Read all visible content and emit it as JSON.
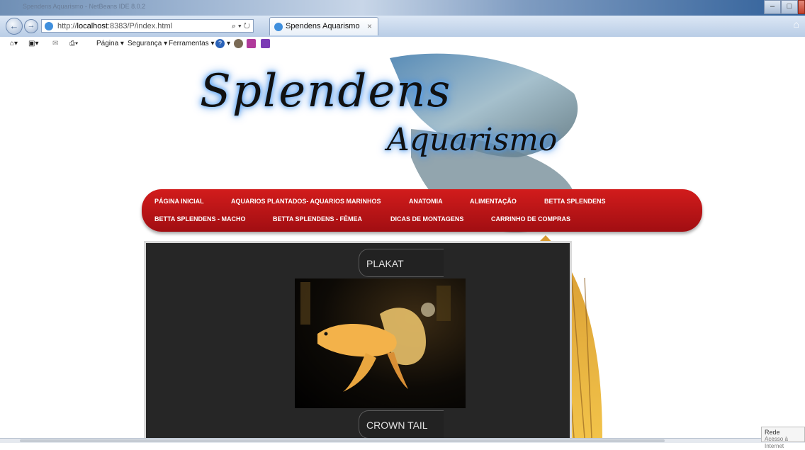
{
  "browser": {
    "window_title": "Spendens Aquarismo - NetBeans IDE 8.0.2",
    "address": {
      "prefix": "http://",
      "host": "localhost",
      "rest": ":8383/P/index.html"
    },
    "tab_title": "Spendens Aquarismo",
    "tab_close": "×",
    "nav_controls": "⌕ ▾ ↻",
    "command_bar": {
      "pagina": "Página ▾",
      "seguranca": "Segurança ▾",
      "ferramentas": "Ferramentas ▾",
      "help": "?"
    }
  },
  "site": {
    "logo_line1": "Splendens",
    "logo_line2": "Aquarismo",
    "menu": [
      "PÁGINA INICIAL",
      "AQUARIOS PLANTADOS- AQUARIOS MARINHOS",
      "ANATOMIA",
      "ALIMENTAÇÃO",
      "BETTA SPLENDENS",
      "BETTA SPLENDENS - MACHO",
      "BETTA SPLENDENS - FÊMEA",
      "DICAS DE MONTAGENS",
      "CARRINHO DE COMPRAS"
    ],
    "gallery": {
      "caption1": "PLAKAT",
      "caption2": "CROWN TAIL"
    }
  },
  "notification": {
    "title": "Rede",
    "subtitle": "Acesso à Internet"
  },
  "colors": {
    "menu_red": "#c0151a",
    "panel": "#262626",
    "ie_blue": "#3f8fdd"
  }
}
